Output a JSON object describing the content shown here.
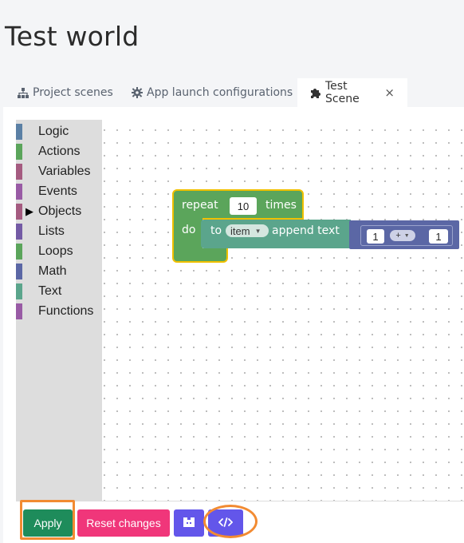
{
  "page": {
    "title": "Test world"
  },
  "tabs": [
    {
      "label": "Project scenes",
      "icon": "sitemap-icon"
    },
    {
      "label": "App launch configurations",
      "icon": "gear-icon"
    },
    {
      "label": "Test Scene",
      "icon": "puzzle-icon",
      "close": "×"
    }
  ],
  "toolbox": {
    "items": [
      {
        "label": "Logic",
        "color": "#5b80a5"
      },
      {
        "label": "Actions",
        "color": "#5ba55b"
      },
      {
        "label": "Variables",
        "color": "#a55b80"
      },
      {
        "label": "Events",
        "color": "#995ba5"
      },
      {
        "label": "Objects",
        "color": "#a55b80",
        "arrow": "▶"
      },
      {
        "label": "Lists",
        "color": "#745ba5"
      },
      {
        "label": "Loops",
        "color": "#5ba55b"
      },
      {
        "label": "Math",
        "color": "#5b67a5"
      },
      {
        "label": "Text",
        "color": "#5ba58c"
      },
      {
        "label": "Functions",
        "color": "#995ba5"
      }
    ]
  },
  "blocks": {
    "repeat": {
      "label": "repeat",
      "count": "10",
      "times": "times",
      "do": "do",
      "color": "#5ba55b",
      "highlight": "#f0c000"
    },
    "append": {
      "to": "to",
      "var": "item",
      "action": "append text",
      "color": "#5ba58c"
    },
    "math": {
      "left": "1",
      "op": "+",
      "right": "1",
      "color": "#5b67a5"
    }
  },
  "actions": {
    "apply": "Apply",
    "reset": "Reset changes",
    "blockly_icon": "blockly-icon",
    "code_icon": "code-icon"
  }
}
